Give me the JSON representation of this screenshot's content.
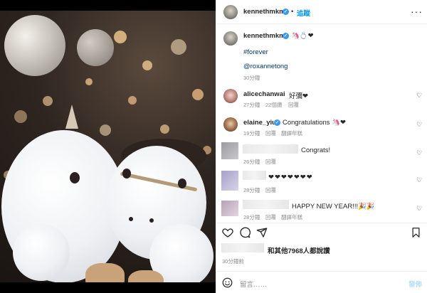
{
  "header": {
    "username": "kennethmkm",
    "follow_label": "追蹤",
    "more_label": "···"
  },
  "caption": {
    "username": "kennethmkm",
    "emoji": "🦄💍❤",
    "hashtag": "#forever",
    "mention": "@roxannetong",
    "time": "30分鐘"
  },
  "comments": [
    {
      "username": "alicechanwai",
      "text": "好彌❤",
      "time": "27分鐘",
      "likes": "22個讚",
      "reply": "回覆"
    },
    {
      "username": "elaine_yiu",
      "text": "Congratulations 🦄❤",
      "time": "19分鐘",
      "reply": "回覆",
      "translate": "翻譯年糕"
    },
    {
      "username": "",
      "text": "Congrats!",
      "time": "26分鐘",
      "reply": "回覆"
    },
    {
      "username": "",
      "text": "❤❤❤❤❤❤❤",
      "time": "28分鐘",
      "reply": "回覆"
    },
    {
      "username": "",
      "text": "HAPPY NEW YEAR!!!🎉🎉",
      "time": "28分鐘",
      "reply": "回覆",
      "translate": "翻譯年糕"
    }
  ],
  "actions": {
    "likes_text": "和其他7968人都說讚",
    "time": "30分鐘前"
  },
  "composer": {
    "placeholder": "留言……",
    "post_label": "發佈"
  },
  "colors": {
    "accent": "#0095f6",
    "verified": "#3897f0",
    "link": "#00376b",
    "muted": "#8e8e8e"
  }
}
